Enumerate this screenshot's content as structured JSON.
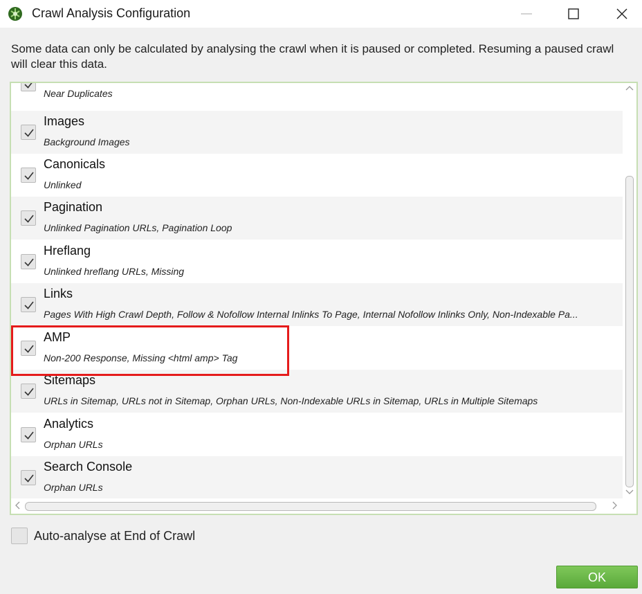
{
  "window": {
    "title": "Crawl Analysis Configuration",
    "icon": "spider-logo-icon"
  },
  "info_text": "Some data can only be calculated by analysing the crawl when it is paused or completed. Resuming a paused crawl will clear this data.",
  "items": [
    {
      "title": "",
      "subtitle": "Near Duplicates",
      "checked": true
    },
    {
      "title": "Images",
      "subtitle": "Background Images",
      "checked": true
    },
    {
      "title": "Canonicals",
      "subtitle": "Unlinked",
      "checked": true
    },
    {
      "title": "Pagination",
      "subtitle": "Unlinked Pagination URLs, Pagination Loop",
      "checked": true
    },
    {
      "title": "Hreflang",
      "subtitle": "Unlinked hreflang URLs, Missing",
      "checked": true
    },
    {
      "title": "Links",
      "subtitle": "Pages With High Crawl Depth, Follow & Nofollow Internal Inlinks To Page, Internal Nofollow Inlinks Only, Non-Indexable Pa...",
      "checked": true
    },
    {
      "title": "AMP",
      "subtitle": "Non-200 Response, Missing <html amp> Tag",
      "checked": true,
      "highlighted": true
    },
    {
      "title": "Sitemaps",
      "subtitle": "URLs in Sitemap, URLs not in Sitemap, Orphan URLs, Non-Indexable URLs in Sitemap, URLs in Multiple Sitemaps",
      "checked": true
    },
    {
      "title": "Analytics",
      "subtitle": "Orphan URLs",
      "checked": true
    },
    {
      "title": "Search Console",
      "subtitle": "Orphan URLs",
      "checked": true
    }
  ],
  "auto_analyse": {
    "label": "Auto-analyse at End of Crawl",
    "checked": false
  },
  "ok_label": "OK",
  "colors": {
    "accent": "#6abb45",
    "highlight": "#e51b1b",
    "panel_border": "#c6dfb3"
  }
}
